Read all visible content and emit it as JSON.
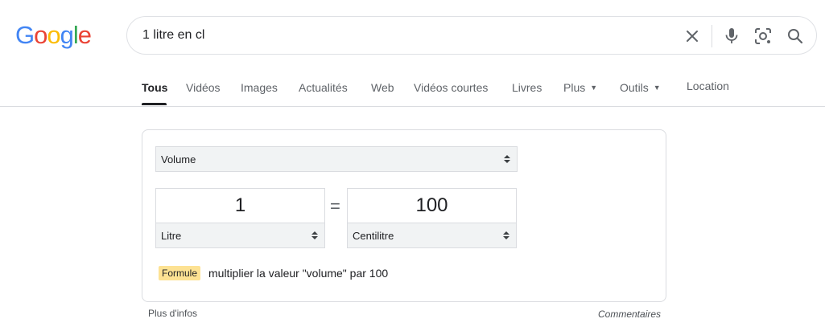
{
  "logo": {
    "letters": [
      "G",
      "o",
      "o",
      "g",
      "l",
      "e"
    ],
    "colors": [
      "#4285F4",
      "#EA4335",
      "#FBBC05",
      "#4285F4",
      "#34A853",
      "#EA4335"
    ]
  },
  "search": {
    "query": "1 litre en cl",
    "icons": [
      "close-icon",
      "mic-icon",
      "lens-icon",
      "search-icon"
    ]
  },
  "tabs": [
    {
      "label": "Tous",
      "active": true
    },
    {
      "label": "Vidéos"
    },
    {
      "label": "Images"
    },
    {
      "label": "Actualités"
    },
    {
      "label": "Web"
    },
    {
      "label": "Vidéos courtes"
    },
    {
      "label": "Livres"
    },
    {
      "label": "Plus",
      "dropdown": true
    },
    {
      "label": "Outils",
      "dropdown": true
    },
    {
      "label": "Location"
    }
  ],
  "converter": {
    "category": "Volume",
    "from_value": "1",
    "from_unit": "Litre",
    "to_value": "100",
    "to_unit": "Centilitre",
    "equals": "=",
    "formula_label": "Formule",
    "formula_text": "multiplier la valeur \"volume\" par 100"
  },
  "footer": {
    "more_info": "Plus d'infos",
    "feedback": "Commentaires"
  }
}
